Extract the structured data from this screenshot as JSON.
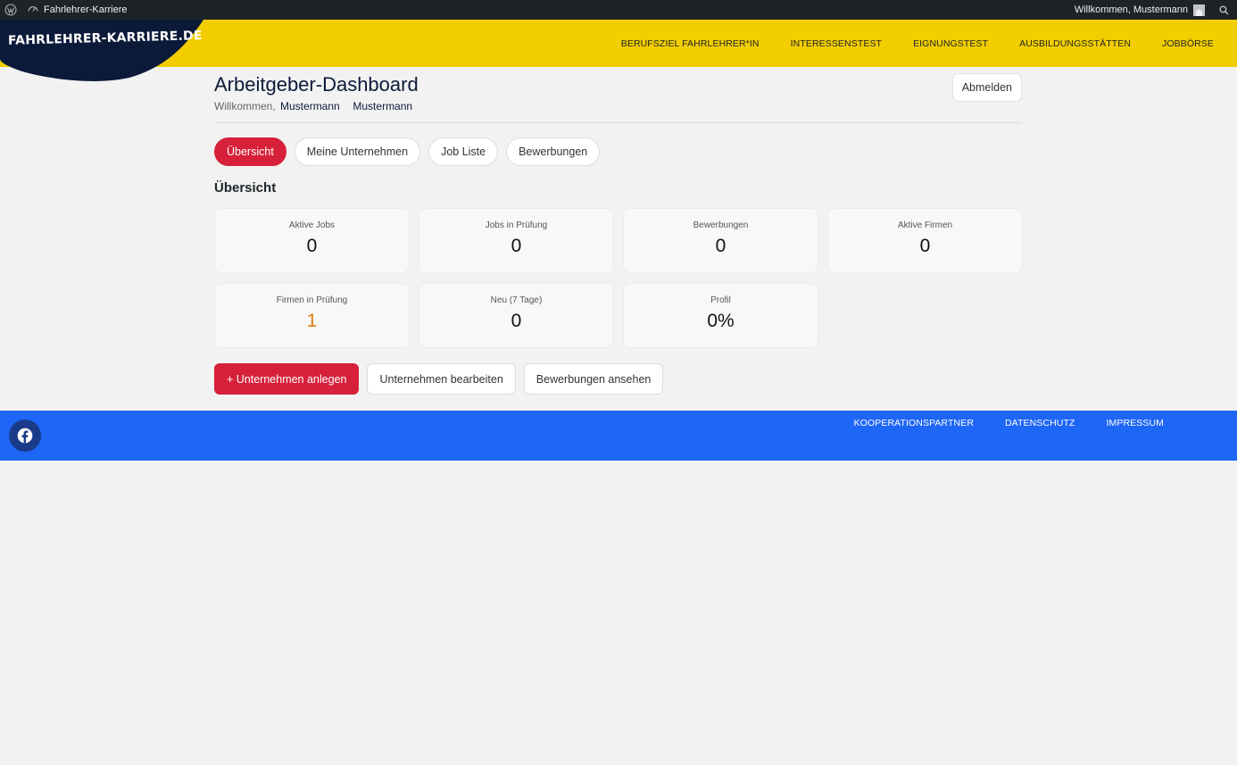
{
  "admin_bar": {
    "site_name": "Fahrlehrer-Karriere",
    "greeting": "Willkommen, Mustermann"
  },
  "header": {
    "logo": "FAHRLEHRER-KARRIERE.DE",
    "nav": [
      "BERUFSZIEL FAHRLEHRER*IN",
      "INTERESSENSTEST",
      "EIGNUNGSTEST",
      "AUSBILDUNGSSTÄTTEN",
      "JOBBÖRSE"
    ]
  },
  "dashboard": {
    "title": "Arbeitgeber-Dashboard",
    "welcome_prefix": "Willkommen,",
    "first_name": "Mustermann",
    "last_name": "Mustermann",
    "logout_label": "Abmelden",
    "tabs": [
      "Übersicht",
      "Meine Unternehmen",
      "Job Liste",
      "Bewerbungen"
    ],
    "active_tab": "Übersicht",
    "section_title": "Übersicht",
    "stats": [
      {
        "label": "Aktive Jobs",
        "value": "0"
      },
      {
        "label": "Jobs in Prüfung",
        "value": "0"
      },
      {
        "label": "Bewerbungen",
        "value": "0"
      },
      {
        "label": "Aktive Firmen",
        "value": "0"
      },
      {
        "label": "Firmen in Prüfung",
        "value": "1"
      },
      {
        "label": "Neu (7 Tage)",
        "value": "0"
      },
      {
        "label": "Profil",
        "value": "0%"
      }
    ],
    "actions": [
      "+ Unternehmen anlegen",
      "Unternehmen bearbeiten",
      "Bewerbungen ansehen"
    ]
  },
  "footer": {
    "social_icon": "facebook-icon",
    "nav": [
      "KOOPERATIONSPARTNER",
      "DATENSCHUTZ",
      "IMPRESSUM"
    ]
  },
  "colors": {
    "header_yellow": "#f2cd00",
    "logo_navy": "#0c1a3a",
    "accent_red": "#d7203a",
    "warning_orange": "#e07a10",
    "footer_blue": "#1e66f5"
  }
}
